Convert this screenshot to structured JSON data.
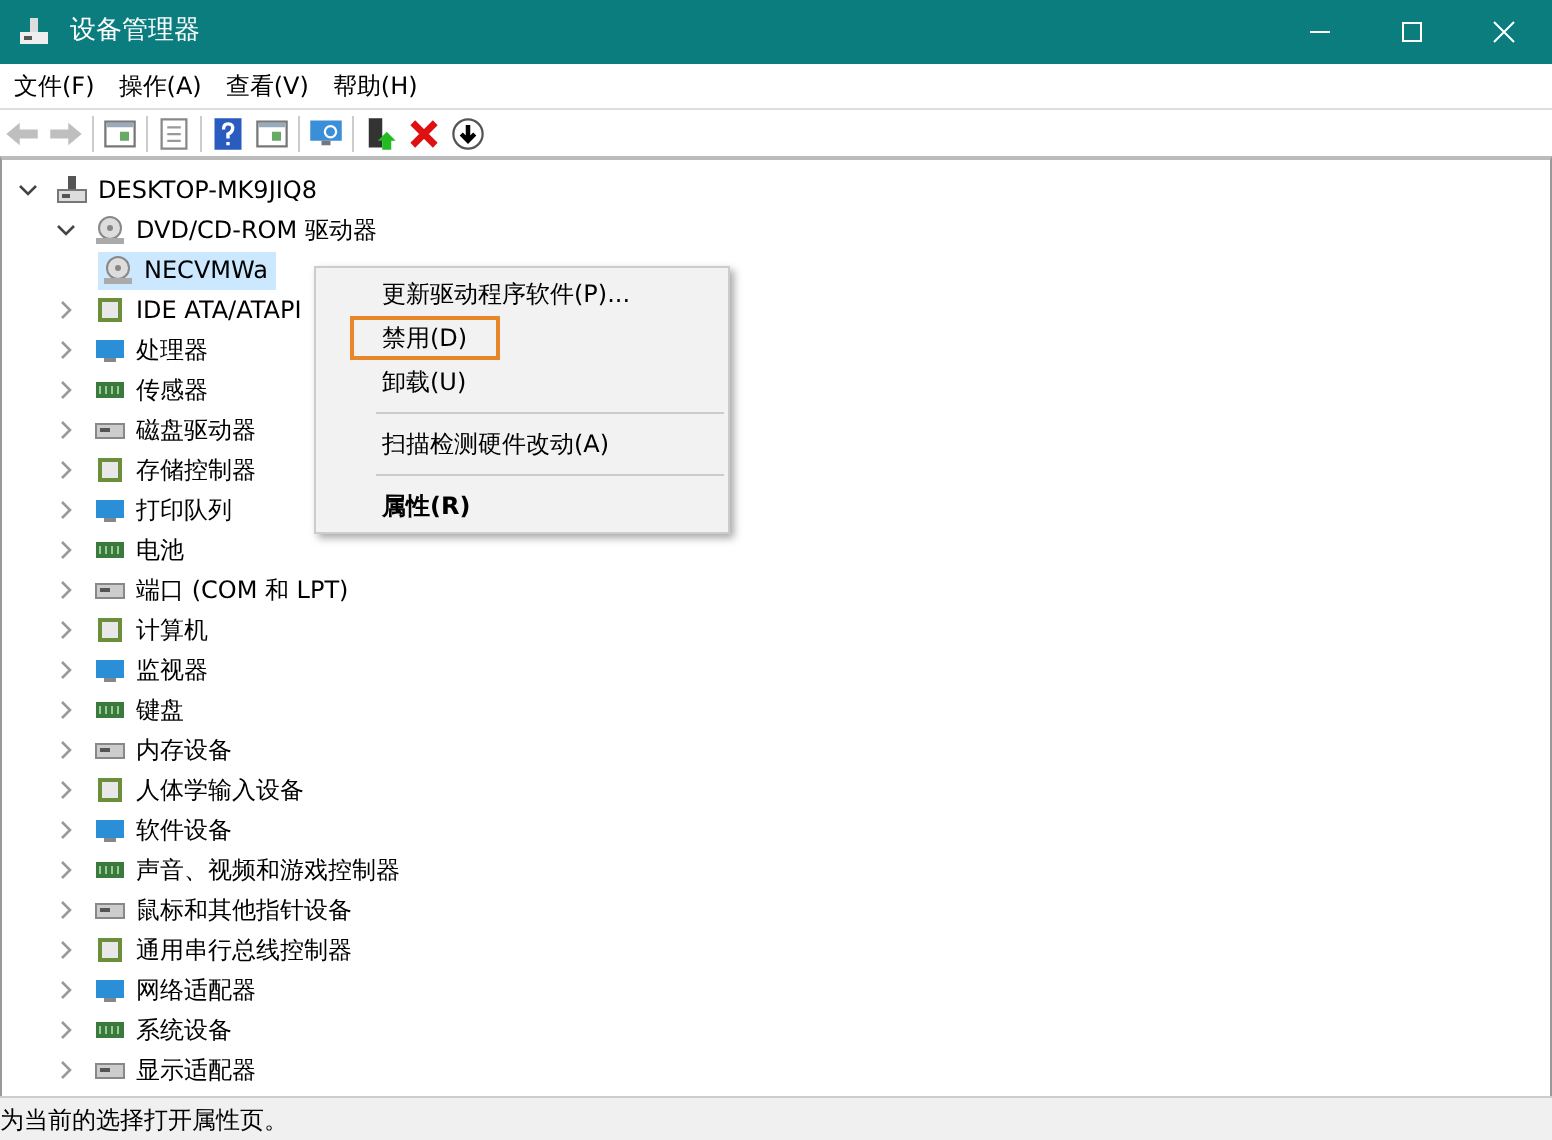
{
  "window": {
    "title": "设备管理器"
  },
  "menu_bar": [
    "文件(F)",
    "操作(A)",
    "查看(V)",
    "帮助(H)"
  ],
  "toolbar": [
    {
      "kind": "back",
      "disabled": true
    },
    {
      "kind": "forward",
      "disabled": true
    },
    {
      "kind": "separator"
    },
    {
      "kind": "panel",
      "disabled": false
    },
    {
      "kind": "separator"
    },
    {
      "kind": "sheet",
      "disabled": false
    },
    {
      "kind": "separator"
    },
    {
      "kind": "help",
      "disabled": false
    },
    {
      "kind": "panel",
      "disabled": false
    },
    {
      "kind": "separator"
    },
    {
      "kind": "monitor",
      "disabled": false
    },
    {
      "kind": "separator"
    },
    {
      "kind": "update",
      "disabled": false
    },
    {
      "kind": "remove",
      "disabled": false
    },
    {
      "kind": "down",
      "disabled": false
    }
  ],
  "tree": [
    {
      "label": "DESKTOP-MK9JIQ8",
      "expanded": true,
      "selected": false,
      "children": [
        {
          "label": "DVD/CD-ROM 驱动器",
          "expanded": true,
          "selected": false,
          "children": [
            {
              "label": "NECVMWa",
              "selected": true
            }
          ]
        },
        {
          "label": "IDE ATA/ATAPI",
          "expanded": false,
          "selected": false
        },
        {
          "label": "处理器",
          "expanded": false,
          "selected": false
        },
        {
          "label": "传感器",
          "expanded": false,
          "selected": false
        },
        {
          "label": "磁盘驱动器",
          "expanded": false,
          "selected": false
        },
        {
          "label": "存储控制器",
          "expanded": false,
          "selected": false
        },
        {
          "label": "打印队列",
          "expanded": false,
          "selected": false
        },
        {
          "label": "电池",
          "expanded": false,
          "selected": false
        },
        {
          "label": "端口 (COM 和 LPT)",
          "expanded": false,
          "selected": false
        },
        {
          "label": "计算机",
          "expanded": false,
          "selected": false
        },
        {
          "label": "监视器",
          "expanded": false,
          "selected": false
        },
        {
          "label": "键盘",
          "expanded": false,
          "selected": false
        },
        {
          "label": "内存设备",
          "expanded": false,
          "selected": false
        },
        {
          "label": "人体学输入设备",
          "expanded": false,
          "selected": false
        },
        {
          "label": "软件设备",
          "expanded": false,
          "selected": false
        },
        {
          "label": "声音、视频和游戏控制器",
          "expanded": false,
          "selected": false
        },
        {
          "label": "鼠标和其他指针设备",
          "expanded": false,
          "selected": false
        },
        {
          "label": "通用串行总线控制器",
          "expanded": false,
          "selected": false
        },
        {
          "label": "网络适配器",
          "expanded": false,
          "selected": false
        },
        {
          "label": "系统设备",
          "expanded": false,
          "selected": false
        },
        {
          "label": "显示适配器",
          "expanded": false,
          "selected": false
        }
      ]
    }
  ],
  "context_menu": [
    {
      "kind": "item",
      "label": "更新驱动程序软件(P)...",
      "highlighted": false,
      "default": false
    },
    {
      "kind": "item",
      "label": "禁用(D)",
      "highlighted": true,
      "default": false
    },
    {
      "kind": "item",
      "label": "卸载(U)",
      "highlighted": false,
      "default": false
    },
    {
      "kind": "separator"
    },
    {
      "kind": "item",
      "label": "扫描检测硬件改动(A)",
      "highlighted": false,
      "default": false
    },
    {
      "kind": "separator"
    },
    {
      "kind": "item",
      "label": "属性(R)",
      "highlighted": false,
      "default": true
    }
  ],
  "status_bar": "为当前的选择打开属性页。"
}
